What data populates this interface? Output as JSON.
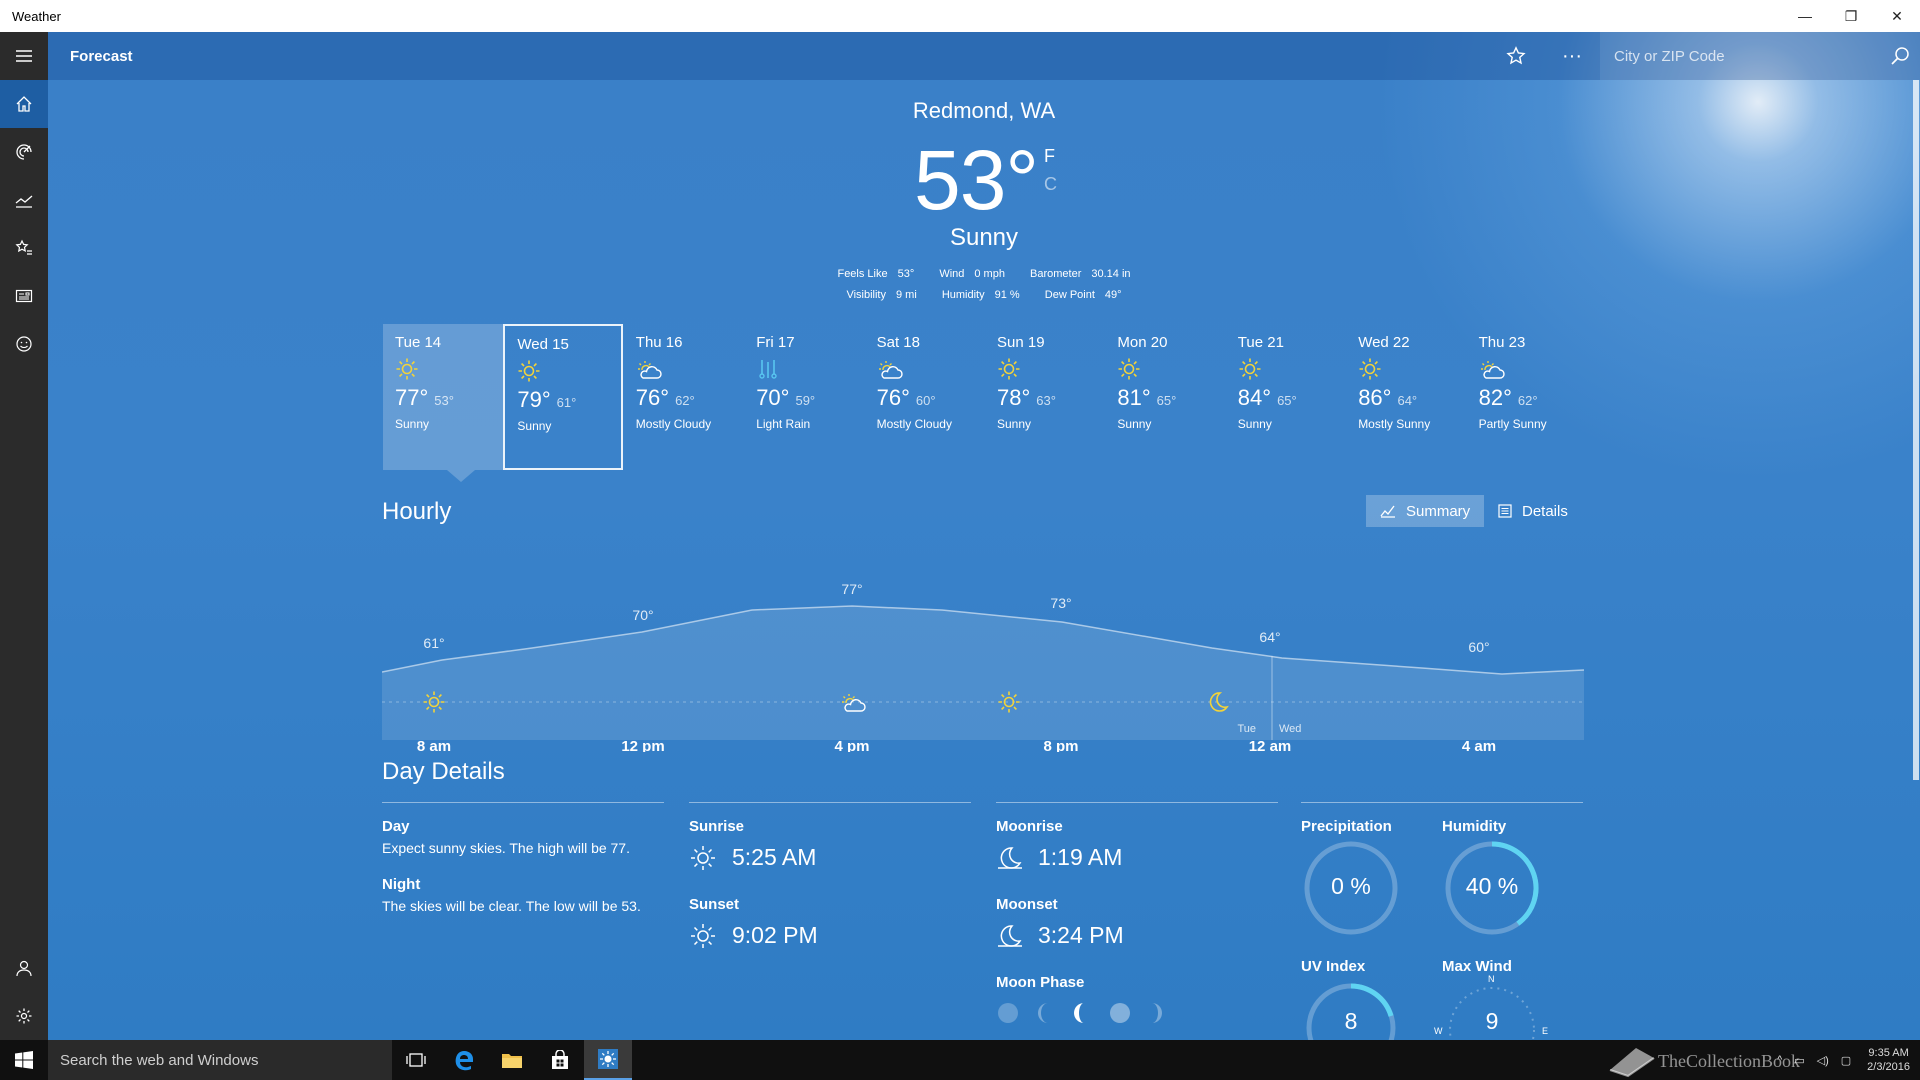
{
  "window": {
    "title": "Weather",
    "minimize": "—",
    "restore": "❐",
    "close": "✕"
  },
  "header": {
    "title": "Forecast",
    "search_placeholder": "City or ZIP Code"
  },
  "current": {
    "location": "Redmond, WA",
    "temp": "53°",
    "unit_f": "F",
    "unit_c": "C",
    "condition": "Sunny",
    "feels_like_label": "Feels Like",
    "feels_like": "53°",
    "wind_label": "Wind",
    "wind": "0 mph",
    "barometer_label": "Barometer",
    "barometer": "30.14 in",
    "visibility_label": "Visibility",
    "visibility": "9 mi",
    "humidity_label": "Humidity",
    "humidity": "91 %",
    "dew_point_label": "Dew Point",
    "dew_point": "49°"
  },
  "daily": [
    {
      "day": "Tue 14",
      "high": "77°",
      "low": "53°",
      "cond": "Sunny",
      "icon": "sun-icon"
    },
    {
      "day": "Wed 15",
      "high": "79°",
      "low": "61°",
      "cond": "Sunny",
      "icon": "sun-icon"
    },
    {
      "day": "Thu 16",
      "high": "76°",
      "low": "62°",
      "cond": "Mostly Cloudy",
      "icon": "cloud-sun-icon"
    },
    {
      "day": "Fri 17",
      "high": "70°",
      "low": "59°",
      "cond": "Light Rain",
      "icon": "rain-icon"
    },
    {
      "day": "Sat 18",
      "high": "76°",
      "low": "60°",
      "cond": "Mostly Cloudy",
      "icon": "cloud-sun-icon"
    },
    {
      "day": "Sun 19",
      "high": "78°",
      "low": "63°",
      "cond": "Sunny",
      "icon": "sun-icon"
    },
    {
      "day": "Mon 20",
      "high": "81°",
      "low": "65°",
      "cond": "Sunny",
      "icon": "sun-icon"
    },
    {
      "day": "Tue 21",
      "high": "84°",
      "low": "65°",
      "cond": "Sunny",
      "icon": "sun-icon"
    },
    {
      "day": "Wed 22",
      "high": "86°",
      "low": "64°",
      "cond": "Mostly Sunny",
      "icon": "sun-icon"
    },
    {
      "day": "Thu 23",
      "high": "82°",
      "low": "62°",
      "cond": "Partly Sunny",
      "icon": "cloud-sun-icon"
    }
  ],
  "hourly": {
    "title": "Hourly",
    "summary_label": "Summary",
    "details_label": "Details",
    "temps": [
      "61°",
      "70°",
      "77°",
      "73°",
      "64°",
      "60°"
    ],
    "times": [
      "8 am",
      "12 pm",
      "4 pm",
      "8 pm",
      "12 am",
      "4 am"
    ],
    "day_left": "Tue",
    "day_right": "Wed"
  },
  "details": {
    "title": "Day Details",
    "day_label": "Day",
    "day_text": "Expect sunny skies. The high will be 77.",
    "night_label": "Night",
    "night_text": "The skies will be clear. The low will be 53.",
    "sunrise_label": "Sunrise",
    "sunrise": "5:25 AM",
    "sunset_label": "Sunset",
    "sunset": "9:02 PM",
    "moonrise_label": "Moonrise",
    "moonrise": "1:19 AM",
    "moonset_label": "Moonset",
    "moonset": "3:24 PM",
    "moon_phase_label": "Moon Phase",
    "precip_label": "Precipitation",
    "precip": "0 %",
    "precip_fraction": 0,
    "humidity_label": "Humidity",
    "humidity": "40 %",
    "humidity_fraction": 0.4,
    "uv_label": "UV Index",
    "uv": "8",
    "wind_label": "Max Wind",
    "wind": "9",
    "compass_n": "N",
    "compass_w": "W",
    "compass_e": "E"
  },
  "taskbar": {
    "search_placeholder": "Search the web and Windows",
    "time": "9:35 AM",
    "date": "2/3/2016",
    "watermark": "TheCollectionBook"
  },
  "colors": {
    "accent": "#2f7cc4",
    "sun": "#f2d33a",
    "rain": "#58c6f0",
    "gauge": "#5fd4f2"
  }
}
